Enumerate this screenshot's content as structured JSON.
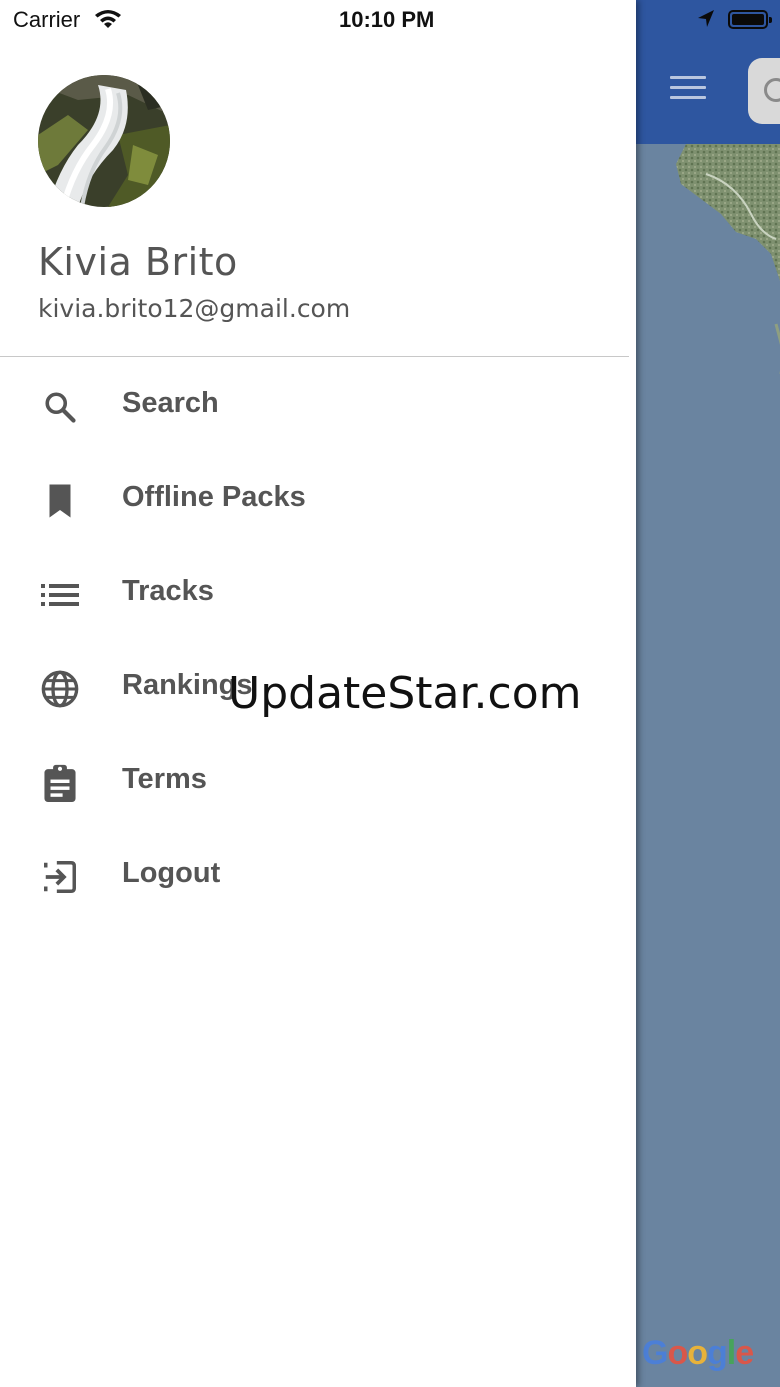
{
  "status_bar": {
    "carrier": "Carrier",
    "time": "10:10 PM"
  },
  "profile": {
    "name": "Kivia Brito",
    "email": "kivia.brito12@gmail.com"
  },
  "menu": {
    "items": [
      {
        "label": "Search",
        "icon": "search-icon"
      },
      {
        "label": "Offline Packs",
        "icon": "bookmark-icon"
      },
      {
        "label": "Tracks",
        "icon": "list-icon"
      },
      {
        "label": "Rankings",
        "icon": "globe-icon"
      },
      {
        "label": "Terms",
        "icon": "clipboard-icon"
      },
      {
        "label": "Logout",
        "icon": "logout-icon"
      }
    ]
  },
  "watermark": "UpdateStar.com",
  "map": {
    "attribution": "Google"
  },
  "colors": {
    "app_bar": "#2e56a0",
    "map_water": "#6a84a0",
    "menu_text": "#555555"
  }
}
